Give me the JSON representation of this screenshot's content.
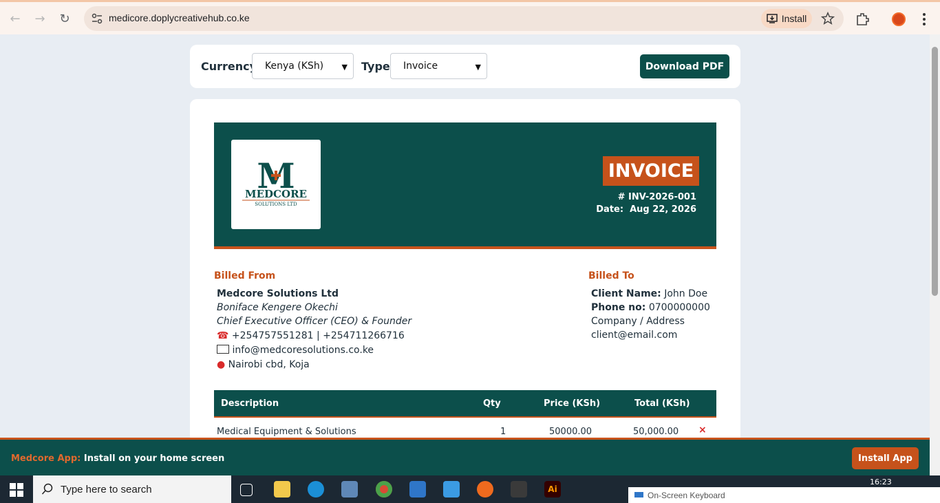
{
  "browser": {
    "url": "medicore.doplycreativehub.co.ke",
    "install_label": "Install"
  },
  "toolbar": {
    "currency_label": "Currency:",
    "currency_value": "Kenya (KSh)",
    "type_label": "Type:",
    "type_value": "Invoice",
    "download_label": "Download PDF"
  },
  "invoice": {
    "badge": "INVOICE",
    "number": "# INV-2026-001",
    "date_label": "Date:",
    "date_value": "Aug 22, 2026",
    "logo_text": "MEDCORE",
    "logo_sub": "SOLUTIONS LTD"
  },
  "billed_from": {
    "title": "Billed From",
    "company": "Medcore Solutions Ltd",
    "person": "Boniface Kengere Okechi",
    "role": "Chief Executive Officer (CEO) & Founder",
    "phone": "+254757551281 | +254711266716",
    "email": "info@medcoresolutions.co.ke",
    "address": "Nairobi cbd, Koja"
  },
  "billed_to": {
    "title": "Billed To",
    "client_label": "Client Name:",
    "client_value": "John Doe",
    "phone_label": "Phone no:",
    "phone_value": "0700000000",
    "company": "Company / Address",
    "email": "client@email.com"
  },
  "table": {
    "headers": [
      "Description",
      "Qty",
      "Price (KSh)",
      "Total (KSh)"
    ],
    "rows": [
      {
        "description": "Medical Equipment & Solutions",
        "qty": "1",
        "price": "50000.00",
        "total": "50,000.00"
      }
    ],
    "remove_symbol": "×"
  },
  "banner": {
    "brand": "Medcore App:",
    "text": "Install on your home screen",
    "button": "Install App"
  },
  "taskbar": {
    "search_placeholder": "Type here to search",
    "osk_label": "On-Screen Keyboard",
    "time": "16:23"
  },
  "colors": {
    "primary": "#0c4f4b",
    "accent": "#c6521b"
  }
}
